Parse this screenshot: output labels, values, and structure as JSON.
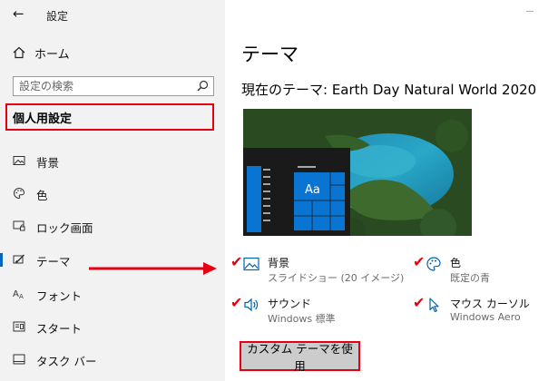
{
  "window": {
    "title": "設定"
  },
  "sidebar": {
    "home_label": "ホーム",
    "search_placeholder": "設定の検索",
    "section_header": "個人用設定",
    "items": [
      {
        "label": "背景",
        "icon": "picture-icon"
      },
      {
        "label": "色",
        "icon": "palette-icon"
      },
      {
        "label": "ロック画面",
        "icon": "lock-screen-icon"
      },
      {
        "label": "テーマ",
        "icon": "theme-brush-icon",
        "active": true
      },
      {
        "label": "フォント",
        "icon": "font-icon"
      },
      {
        "label": "スタート",
        "icon": "start-icon"
      },
      {
        "label": "タスク バー",
        "icon": "taskbar-icon"
      }
    ]
  },
  "main": {
    "title": "テーマ",
    "current_theme": "現在のテーマ: Earth Day Natural World 2020",
    "preview_sample_text": "Aa",
    "settings": [
      {
        "key": "background",
        "label": "背景",
        "value": "スライドショー (20 イメージ)",
        "icon": "picture-icon"
      },
      {
        "key": "color",
        "label": "色",
        "value": "既定の青",
        "icon": "palette-icon"
      },
      {
        "key": "sound",
        "label": "サウンド",
        "value": "Windows 標準",
        "icon": "speaker-icon"
      },
      {
        "key": "cursor",
        "label": "マウス カーソル",
        "value": "Windows Aero",
        "icon": "mouse-cursor-icon"
      }
    ],
    "use_custom_button": "カスタム テーマを使用"
  },
  "colors": {
    "accent": "#0067c0",
    "highlight_red": "#e60012",
    "sidebar_bg": "#f2f2f2",
    "button_bg": "#cccccc"
  }
}
